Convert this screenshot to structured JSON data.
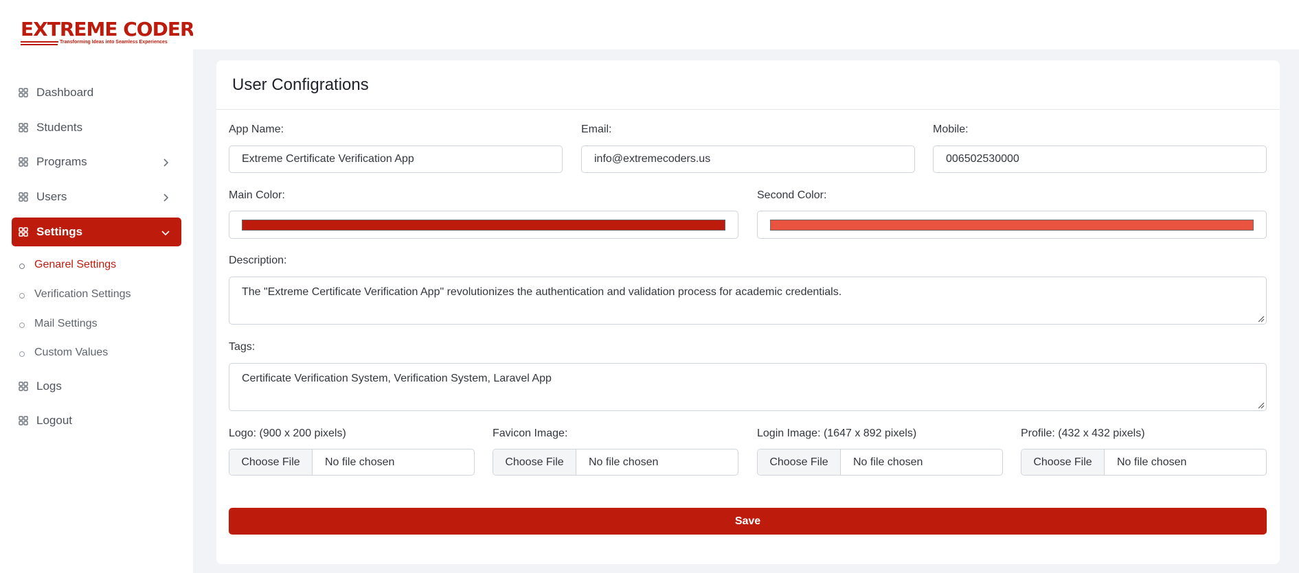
{
  "brand": {
    "name": "EXTREME CODERS",
    "tagline": "Transforming Ideas into Seamless Experiences",
    "color": "#bd1c0d"
  },
  "sidebar": {
    "items": [
      {
        "label": "Dashboard",
        "icon": "grid-icon"
      },
      {
        "label": "Students",
        "icon": "grid-icon"
      },
      {
        "label": "Programs",
        "icon": "grid-icon",
        "chevron": "chevron-right-icon"
      },
      {
        "label": "Users",
        "icon": "grid-icon",
        "chevron": "chevron-right-icon"
      },
      {
        "label": "Settings",
        "icon": "grid-icon",
        "chevron": "chevron-down-icon",
        "active": true
      },
      {
        "label": "Logs",
        "icon": "grid-icon"
      },
      {
        "label": "Logout",
        "icon": "grid-icon"
      }
    ],
    "settings_submenu": [
      {
        "label": "Genarel Settings",
        "current": true
      },
      {
        "label": "Verification Settings"
      },
      {
        "label": "Mail Settings"
      },
      {
        "label": "Custom Values"
      }
    ]
  },
  "form": {
    "title": "User Configrations",
    "app_name": {
      "label": "App Name:",
      "value": "Extreme Certificate Verification App"
    },
    "email": {
      "label": "Email:",
      "value": "info@extremecoders.us"
    },
    "mobile": {
      "label": "Mobile:",
      "value": "006502530000"
    },
    "main_color": {
      "label": "Main Color:",
      "value": "#bd1c0d"
    },
    "second_color": {
      "label": "Second Color:",
      "value": "#e95440"
    },
    "description": {
      "label": "Description:",
      "value": "The \"Extreme Certificate Verification App\" revolutionizes the authentication and validation process for academic credentials."
    },
    "tags": {
      "label": "Tags:",
      "value": "Certificate Verification System, Verification System, Laravel App"
    },
    "files": [
      {
        "label": "Logo: (900 x 200 pixels)",
        "button": "Choose File",
        "status": "No file chosen"
      },
      {
        "label": "Favicon Image:",
        "button": "Choose File",
        "status": "No file chosen"
      },
      {
        "label": "Login Image: (1647 x 892 pixels)",
        "button": "Choose File",
        "status": "No file chosen"
      },
      {
        "label": "Profile: (432 x 432 pixels)",
        "button": "Choose File",
        "status": "No file chosen"
      }
    ],
    "save_label": "Save"
  }
}
